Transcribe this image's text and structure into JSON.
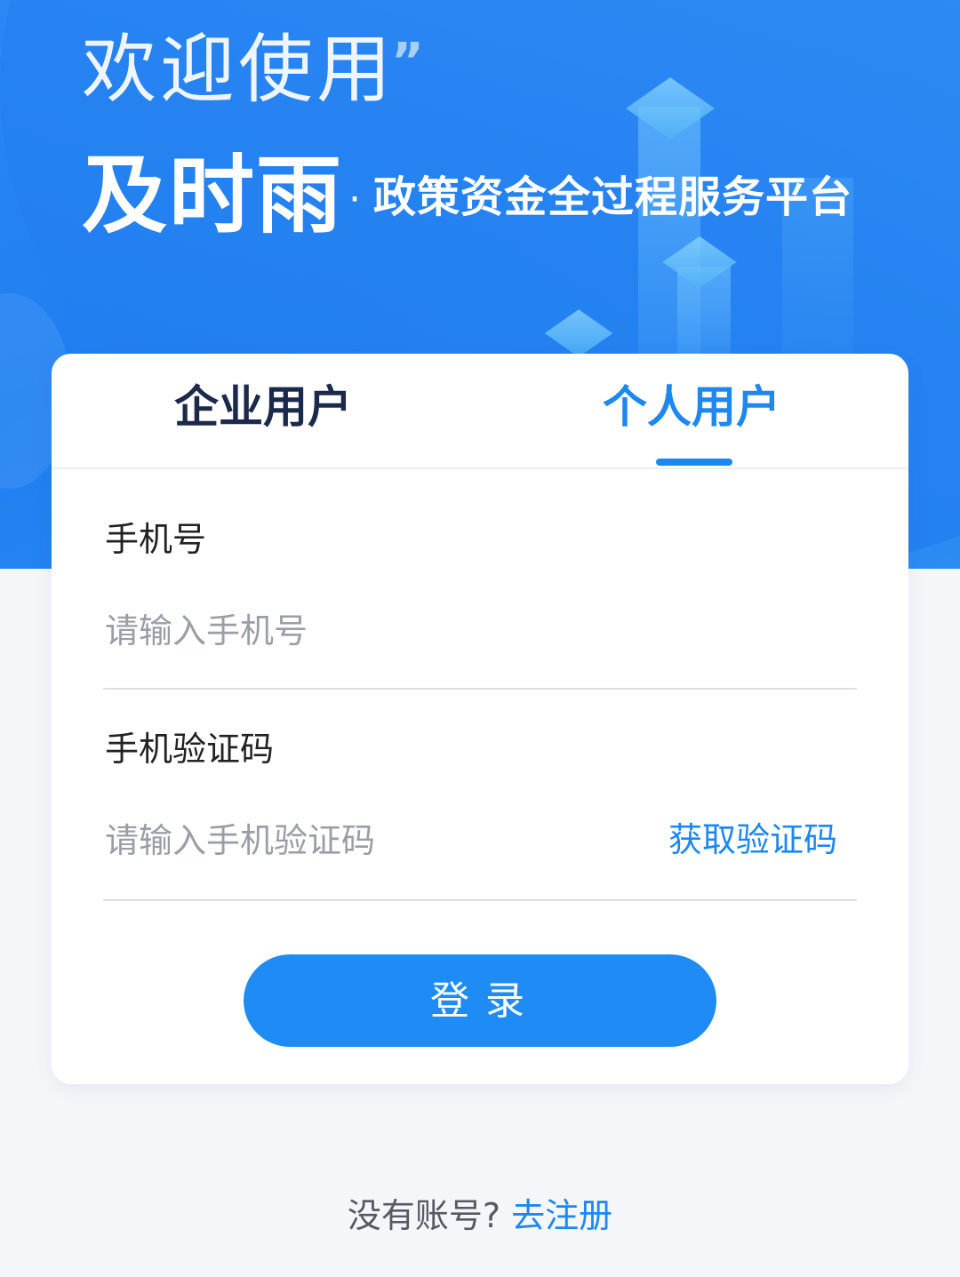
{
  "header": {
    "welcome": "欢迎使用",
    "quote_mark": "”",
    "brand": "及时雨",
    "separator": "·",
    "subtitle": "政策资金全过程服务平台"
  },
  "tabs": [
    {
      "label": "企业用户",
      "active": false
    },
    {
      "label": "个人用户",
      "active": true
    }
  ],
  "form": {
    "phone_label": "手机号",
    "phone_placeholder": "请输入手机号",
    "code_label": "手机验证码",
    "code_placeholder": "请输入手机验证码",
    "get_code": "获取验证码",
    "login": "登录"
  },
  "footer": {
    "question": "没有账号?",
    "register": "去注册"
  },
  "colors": {
    "primary": "#1e88f0",
    "hero": "#2a88f5",
    "background": "#f5f6f9"
  }
}
